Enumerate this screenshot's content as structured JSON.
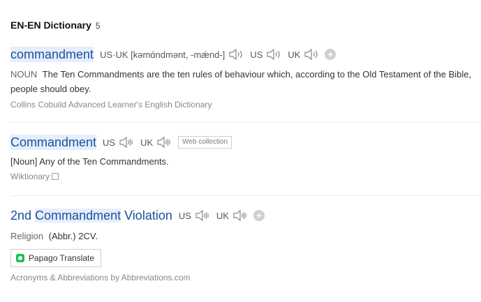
{
  "section": {
    "title": "EN-EN Dictionary",
    "count": "5"
  },
  "entries": [
    {
      "headword": "commandment",
      "pron_label": "US·UK",
      "pron_text": "[kəmɑ́ndmənt, -mǽnd-]",
      "us_label": "US",
      "uk_label": "UK",
      "pos": "NOUN",
      "definition": "The Ten Commandments are the ten rules of behaviour which, according to the Old Testament of the Bible, people should obey.",
      "source": "Collins Cobuild Advanced Learner's English Dictionary"
    },
    {
      "headword": "Commandment",
      "us_label": "US",
      "uk_label": "UK",
      "tag": "Web collection",
      "definition": "[Noun] Any of the Ten Commandments.",
      "source": "Wiktionary"
    },
    {
      "headword_prefix": "2nd",
      "headword_main": "Commandment",
      "headword_suffix": "Violation",
      "us_label": "US",
      "uk_label": "UK",
      "pos": "Religion",
      "definition": "(Abbr.) 2CV.",
      "translate_button": "Papago Translate",
      "source": "Acronyms & Abbreviations by Abbreviations.com"
    }
  ]
}
